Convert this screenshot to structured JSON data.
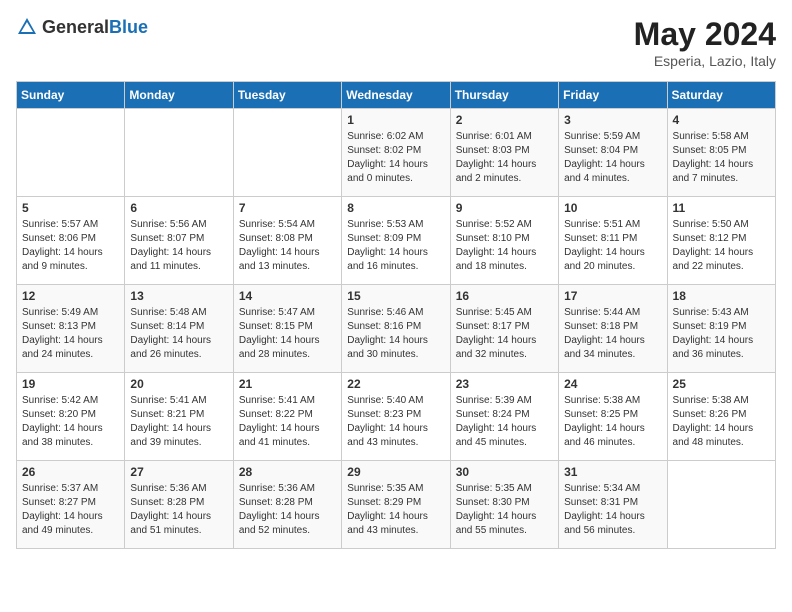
{
  "header": {
    "logo_general": "General",
    "logo_blue": "Blue",
    "month": "May 2024",
    "location": "Esperia, Lazio, Italy"
  },
  "days_of_week": [
    "Sunday",
    "Monday",
    "Tuesday",
    "Wednesday",
    "Thursday",
    "Friday",
    "Saturday"
  ],
  "weeks": [
    [
      {
        "day": "",
        "sunrise": "",
        "sunset": "",
        "daylight": ""
      },
      {
        "day": "",
        "sunrise": "",
        "sunset": "",
        "daylight": ""
      },
      {
        "day": "",
        "sunrise": "",
        "sunset": "",
        "daylight": ""
      },
      {
        "day": "1",
        "sunrise": "Sunrise: 6:02 AM",
        "sunset": "Sunset: 8:02 PM",
        "daylight": "Daylight: 14 hours and 0 minutes."
      },
      {
        "day": "2",
        "sunrise": "Sunrise: 6:01 AM",
        "sunset": "Sunset: 8:03 PM",
        "daylight": "Daylight: 14 hours and 2 minutes."
      },
      {
        "day": "3",
        "sunrise": "Sunrise: 5:59 AM",
        "sunset": "Sunset: 8:04 PM",
        "daylight": "Daylight: 14 hours and 4 minutes."
      },
      {
        "day": "4",
        "sunrise": "Sunrise: 5:58 AM",
        "sunset": "Sunset: 8:05 PM",
        "daylight": "Daylight: 14 hours and 7 minutes."
      }
    ],
    [
      {
        "day": "5",
        "sunrise": "Sunrise: 5:57 AM",
        "sunset": "Sunset: 8:06 PM",
        "daylight": "Daylight: 14 hours and 9 minutes."
      },
      {
        "day": "6",
        "sunrise": "Sunrise: 5:56 AM",
        "sunset": "Sunset: 8:07 PM",
        "daylight": "Daylight: 14 hours and 11 minutes."
      },
      {
        "day": "7",
        "sunrise": "Sunrise: 5:54 AM",
        "sunset": "Sunset: 8:08 PM",
        "daylight": "Daylight: 14 hours and 13 minutes."
      },
      {
        "day": "8",
        "sunrise": "Sunrise: 5:53 AM",
        "sunset": "Sunset: 8:09 PM",
        "daylight": "Daylight: 14 hours and 16 minutes."
      },
      {
        "day": "9",
        "sunrise": "Sunrise: 5:52 AM",
        "sunset": "Sunset: 8:10 PM",
        "daylight": "Daylight: 14 hours and 18 minutes."
      },
      {
        "day": "10",
        "sunrise": "Sunrise: 5:51 AM",
        "sunset": "Sunset: 8:11 PM",
        "daylight": "Daylight: 14 hours and 20 minutes."
      },
      {
        "day": "11",
        "sunrise": "Sunrise: 5:50 AM",
        "sunset": "Sunset: 8:12 PM",
        "daylight": "Daylight: 14 hours and 22 minutes."
      }
    ],
    [
      {
        "day": "12",
        "sunrise": "Sunrise: 5:49 AM",
        "sunset": "Sunset: 8:13 PM",
        "daylight": "Daylight: 14 hours and 24 minutes."
      },
      {
        "day": "13",
        "sunrise": "Sunrise: 5:48 AM",
        "sunset": "Sunset: 8:14 PM",
        "daylight": "Daylight: 14 hours and 26 minutes."
      },
      {
        "day": "14",
        "sunrise": "Sunrise: 5:47 AM",
        "sunset": "Sunset: 8:15 PM",
        "daylight": "Daylight: 14 hours and 28 minutes."
      },
      {
        "day": "15",
        "sunrise": "Sunrise: 5:46 AM",
        "sunset": "Sunset: 8:16 PM",
        "daylight": "Daylight: 14 hours and 30 minutes."
      },
      {
        "day": "16",
        "sunrise": "Sunrise: 5:45 AM",
        "sunset": "Sunset: 8:17 PM",
        "daylight": "Daylight: 14 hours and 32 minutes."
      },
      {
        "day": "17",
        "sunrise": "Sunrise: 5:44 AM",
        "sunset": "Sunset: 8:18 PM",
        "daylight": "Daylight: 14 hours and 34 minutes."
      },
      {
        "day": "18",
        "sunrise": "Sunrise: 5:43 AM",
        "sunset": "Sunset: 8:19 PM",
        "daylight": "Daylight: 14 hours and 36 minutes."
      }
    ],
    [
      {
        "day": "19",
        "sunrise": "Sunrise: 5:42 AM",
        "sunset": "Sunset: 8:20 PM",
        "daylight": "Daylight: 14 hours and 38 minutes."
      },
      {
        "day": "20",
        "sunrise": "Sunrise: 5:41 AM",
        "sunset": "Sunset: 8:21 PM",
        "daylight": "Daylight: 14 hours and 39 minutes."
      },
      {
        "day": "21",
        "sunrise": "Sunrise: 5:41 AM",
        "sunset": "Sunset: 8:22 PM",
        "daylight": "Daylight: 14 hours and 41 minutes."
      },
      {
        "day": "22",
        "sunrise": "Sunrise: 5:40 AM",
        "sunset": "Sunset: 8:23 PM",
        "daylight": "Daylight: 14 hours and 43 minutes."
      },
      {
        "day": "23",
        "sunrise": "Sunrise: 5:39 AM",
        "sunset": "Sunset: 8:24 PM",
        "daylight": "Daylight: 14 hours and 45 minutes."
      },
      {
        "day": "24",
        "sunrise": "Sunrise: 5:38 AM",
        "sunset": "Sunset: 8:25 PM",
        "daylight": "Daylight: 14 hours and 46 minutes."
      },
      {
        "day": "25",
        "sunrise": "Sunrise: 5:38 AM",
        "sunset": "Sunset: 8:26 PM",
        "daylight": "Daylight: 14 hours and 48 minutes."
      }
    ],
    [
      {
        "day": "26",
        "sunrise": "Sunrise: 5:37 AM",
        "sunset": "Sunset: 8:27 PM",
        "daylight": "Daylight: 14 hours and 49 minutes."
      },
      {
        "day": "27",
        "sunrise": "Sunrise: 5:36 AM",
        "sunset": "Sunset: 8:28 PM",
        "daylight": "Daylight: 14 hours and 51 minutes."
      },
      {
        "day": "28",
        "sunrise": "Sunrise: 5:36 AM",
        "sunset": "Sunset: 8:28 PM",
        "daylight": "Daylight: 14 hours and 52 minutes."
      },
      {
        "day": "29",
        "sunrise": "Sunrise: 5:35 AM",
        "sunset": "Sunset: 8:29 PM",
        "daylight": "Daylight: 14 hours and 43 minutes."
      },
      {
        "day": "30",
        "sunrise": "Sunrise: 5:35 AM",
        "sunset": "Sunset: 8:30 PM",
        "daylight": "Daylight: 14 hours and 55 minutes."
      },
      {
        "day": "31",
        "sunrise": "Sunrise: 5:34 AM",
        "sunset": "Sunset: 8:31 PM",
        "daylight": "Daylight: 14 hours and 56 minutes."
      },
      {
        "day": "",
        "sunrise": "",
        "sunset": "",
        "daylight": ""
      }
    ]
  ]
}
